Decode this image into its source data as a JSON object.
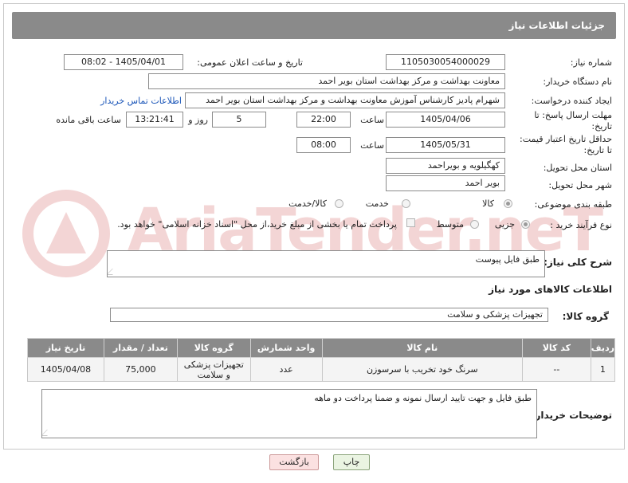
{
  "header": {
    "title": "جزئیات اطلاعات نیاز"
  },
  "form": {
    "need_number_label": "شماره نیاز:",
    "need_number": "1105030054000029",
    "announce_label": "تاریخ و ساعت اعلان عمومی:",
    "announce_value": "1405/04/01 - 08:02",
    "buyer_label": "نام دستگاه خریدار:",
    "buyer_value": "معاونت بهداشت و مرکز بهداشت استان بویر احمد",
    "creator_label": "ایجاد کننده درخواست:",
    "creator_value": "شهرام پادیز کارشناس آموزش معاونت بهداشت و مرکز بهداشت استان بویر احمد",
    "contact_link": "اطلاعات تماس خریدار",
    "reply_deadline_label": "مهلت ارسال پاسخ: تا تاریخ:",
    "reply_date": "1405/04/06",
    "time_label": "ساعت",
    "reply_time": "22:00",
    "days_value": "5",
    "days_label": "روز و",
    "remaining_time": "13:21:41",
    "remaining_label": "ساعت باقی مانده",
    "price_deadline_label": "حداقل تاریخ اعتبار قیمت: تا تاریخ:",
    "price_date": "1405/05/31",
    "price_time_label": "ساعت",
    "price_time": "08:00",
    "province_label": "استان محل تحویل:",
    "province_value": "کهگیلویه و بویراحمد",
    "city_label": "شهر محل تحویل:",
    "city_value": "بویر احمد",
    "category_label": "طبقه بندی موضوعی:",
    "category_options": [
      "کالا",
      "خدمت",
      "کالا/خدمت"
    ],
    "category_selected": "کالا",
    "process_label": "نوع فرآیند خرید :",
    "process_options": [
      "جزیی",
      "متوسط"
    ],
    "process_selected": "جزیی",
    "payment_note": "پرداخت تمام یا بخشی از مبلغ خرید،از محل \"اسناد خزانه اسلامی\" خواهد بود.",
    "description_label": "شرح کلی نیاز:",
    "description_value": "طبق فایل پیوست",
    "goods_info_title": "اطلاعات کالاهای مورد نیاز",
    "goods_group_label": "گروه کالا:",
    "goods_group_value": "تجهیزات پزشکی و سلامت"
  },
  "table": {
    "headers": [
      "ردیف",
      "کد کالا",
      "نام کالا",
      "واحد شمارش",
      "گروه کالا",
      "تعداد / مقدار",
      "تاریخ نیاز"
    ],
    "rows": [
      [
        "1",
        "--",
        "سرنگ خود تخریب با سرسوزن",
        "عدد",
        "تجهیزات پزشکی و سلامت",
        "75,000",
        "1405/04/08"
      ]
    ]
  },
  "buyer_notes_label": "توضیحات خریدار:",
  "buyer_notes_value": "طبق فایل و جهت تایید ارسال نمونه و ضمنا پرداخت دو ماهه",
  "buttons": {
    "print": "چاپ",
    "back": "بازگشت"
  },
  "watermark_text": "AriaTender.neT",
  "colors": {
    "header_bg": "#8a8a8a",
    "link": "#1a55b8",
    "watermark": "#bb0000"
  }
}
